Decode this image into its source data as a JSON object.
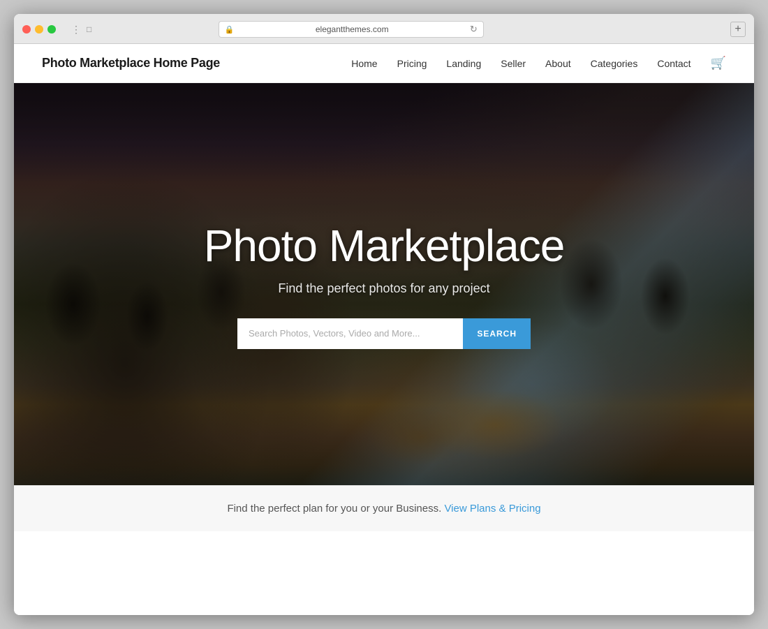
{
  "browser": {
    "url": "elegantthemes.com",
    "traffic_light_red": "●",
    "traffic_light_yellow": "●",
    "traffic_light_green": "●",
    "new_tab_label": "+"
  },
  "header": {
    "logo": "Photo Marketplace Home Page",
    "nav": {
      "home": "Home",
      "pricing": "Pricing",
      "landing": "Landing",
      "seller": "Seller",
      "about": "About",
      "categories": "Categories",
      "contact": "Contact"
    }
  },
  "hero": {
    "title": "Photo Marketplace",
    "subtitle": "Find the perfect photos for any project",
    "search_placeholder": "Search Photos, Vectors, Video and More...",
    "search_button": "SEARCH"
  },
  "plans_bar": {
    "text": "Find the perfect plan for you or your Business.",
    "link_text": "View Plans & Pricing"
  }
}
